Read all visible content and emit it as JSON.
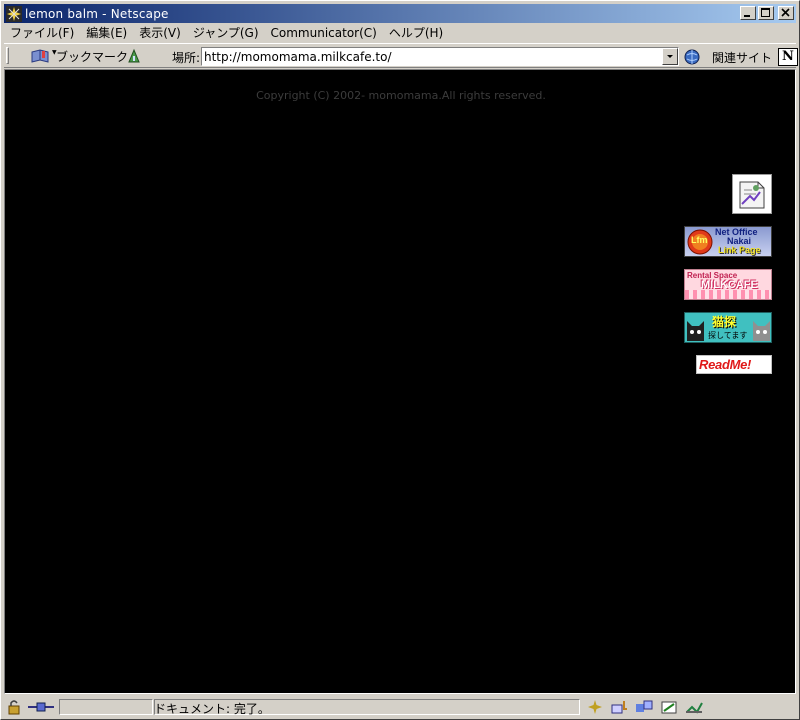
{
  "window": {
    "title": "lemon  balm - Netscape"
  },
  "menubar": {
    "items": [
      "ファイル(F)",
      "編集(E)",
      "表示(V)",
      "ジャンプ(G)",
      "Communicator(C)",
      "ヘルプ(H)"
    ]
  },
  "toolbar": {
    "bookmarks_label": "ブックマーク",
    "location_label": "場所:",
    "url": "http://momomama.milkcafe.to/",
    "related_label": "関連サイト"
  },
  "page": {
    "copyright": "Copyright (C) 2002- momomama.All rights reserved.",
    "banners": {
      "net_office_line1": "Net Office",
      "net_office_line2": "Nakai",
      "net_office_line3": "Link Page",
      "net_office_logo": "Lfm",
      "milkcafe_line1": "Rental Space",
      "milkcafe_line2": "MILKCAFE",
      "neko_line1": "猫探",
      "neko_line2": "探してます",
      "readme": "ReadMe!"
    }
  },
  "statusbar": {
    "text": "ドキュメント: 完了。"
  },
  "colors": {
    "title_start": "#0a246a",
    "title_end": "#a6caf0",
    "content_bg": "#000000",
    "chrome": "#d4d0c8"
  }
}
